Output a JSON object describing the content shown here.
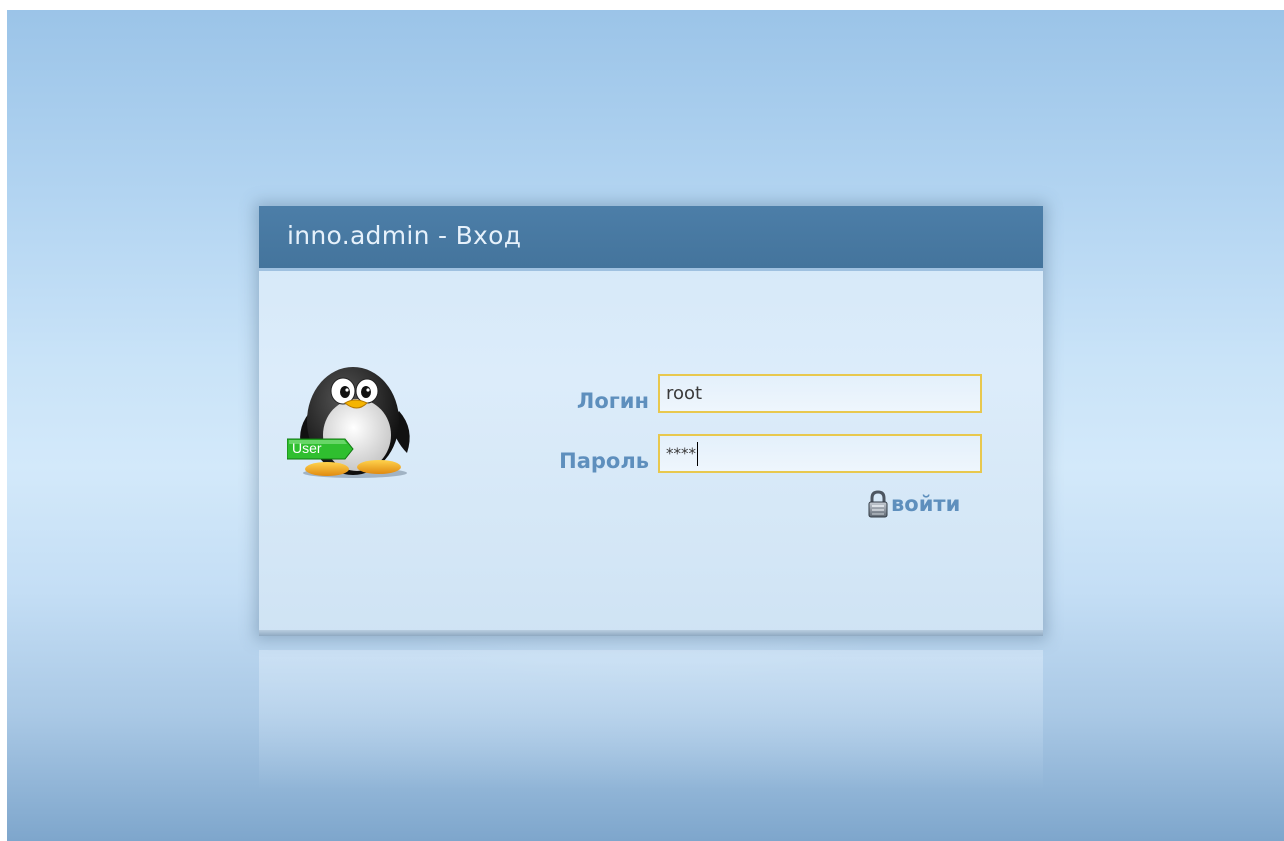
{
  "dialog": {
    "title": "inno.admin - Вход"
  },
  "mascot": {
    "badge": "User",
    "icon": "penguin-user-icon"
  },
  "form": {
    "login_label": "Логин",
    "login_value": "root",
    "password_label": "Пароль",
    "password_value": "****",
    "submit_label": "войти",
    "submit_icon": "padlock-icon"
  },
  "colors": {
    "titlebar": "#4778a2",
    "label": "#5e8fbd",
    "field_border": "#e8c84e"
  }
}
